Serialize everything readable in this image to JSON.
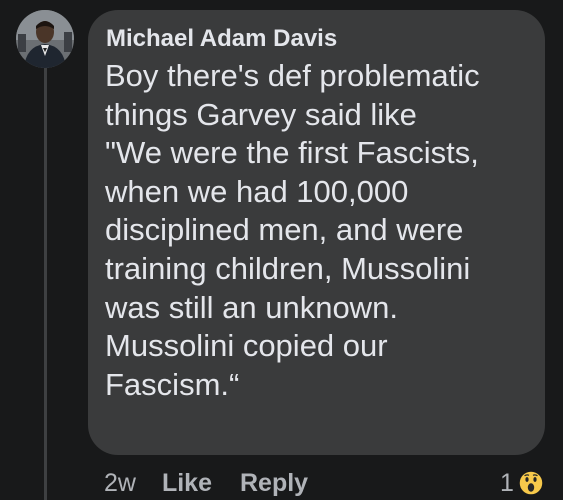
{
  "comment": {
    "author": "Michael Adam Davis",
    "text_lines": [
      "Boy there's def problematic",
      "things Garvey said like",
      "\"We were the first Fascists,",
      "when we had 100,000",
      "disciplined men, and were",
      "training children, Mussolini",
      "was still an unknown.",
      "Mussolini copied our",
      "Fascism.“"
    ],
    "avatar_icon": "profile-photo"
  },
  "actions": {
    "time": "2w",
    "like_label": "Like",
    "reply_label": "Reply"
  },
  "reactions": {
    "count": "1",
    "icon": "wow-reaction-icon"
  },
  "colors": {
    "background": "#18191a",
    "bubble": "#3a3b3c",
    "text": "#e4e6eb",
    "secondary_text": "#b0b3b8",
    "wow_yellow": "#f7c94b"
  }
}
